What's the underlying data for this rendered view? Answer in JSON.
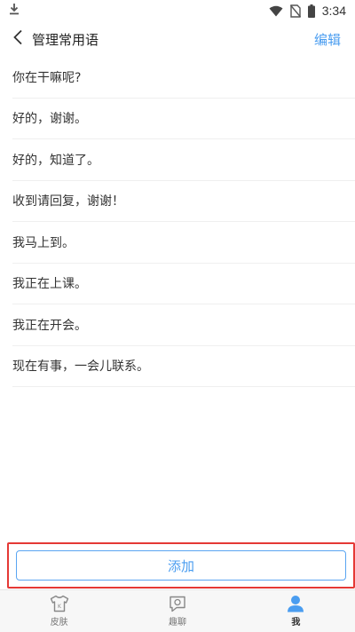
{
  "status_bar": {
    "time": "3:34",
    "icons": [
      "download-icon",
      "wifi-icon",
      "no-sim-icon",
      "battery-icon"
    ]
  },
  "header": {
    "title": "管理常用语",
    "edit_label": "编辑",
    "back_icon": "chevron-left-icon"
  },
  "phrases": [
    {
      "text": "你在干嘛呢?"
    },
    {
      "text": "好的，谢谢。"
    },
    {
      "text": "好的，知道了。"
    },
    {
      "text": "收到请回复，谢谢！"
    },
    {
      "text": "我马上到。"
    },
    {
      "text": "我正在上课。"
    },
    {
      "text": "我正在开会。"
    },
    {
      "text": "现在有事，一会儿联系。"
    }
  ],
  "add_button": {
    "label": "添加"
  },
  "bottom_nav": {
    "items": [
      {
        "label": "皮肤",
        "icon": "tshirt-icon",
        "active": false
      },
      {
        "label": "趣聊",
        "icon": "chat-icon",
        "active": false
      },
      {
        "label": "我",
        "icon": "user-icon",
        "active": true
      }
    ]
  },
  "colors": {
    "accent": "#4a9df0",
    "highlight_border": "#e53935",
    "divider": "#efefef"
  }
}
